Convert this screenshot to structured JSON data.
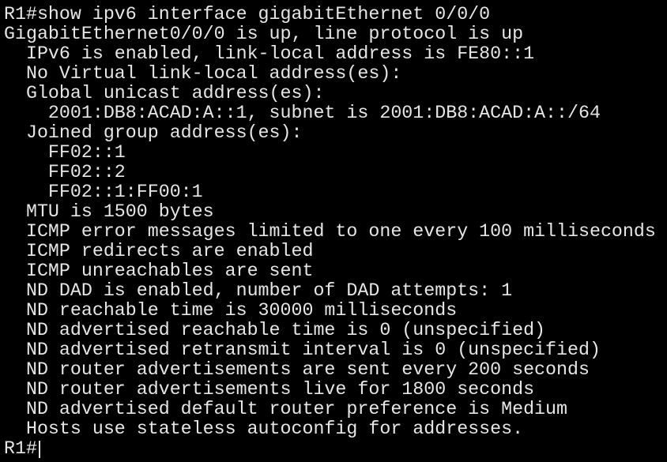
{
  "terminal": {
    "colors": {
      "background": "#000000",
      "text": "#e6e6e6"
    },
    "lines": [
      "R1#show ipv6 interface gigabitEthernet 0/0/0",
      "GigabitEthernet0/0/0 is up, line protocol is up",
      "  IPv6 is enabled, link-local address is FE80::1",
      "  No Virtual link-local address(es):",
      "  Global unicast address(es):",
      "    2001:DB8:ACAD:A::1, subnet is 2001:DB8:ACAD:A::/64",
      "  Joined group address(es):",
      "    FF02::1",
      "    FF02::2",
      "    FF02::1:FF00:1",
      "  MTU is 1500 bytes",
      "  ICMP error messages limited to one every 100 milliseconds",
      "  ICMP redirects are enabled",
      "  ICMP unreachables are sent",
      "  ND DAD is enabled, number of DAD attempts: 1",
      "  ND reachable time is 30000 milliseconds",
      "  ND advertised reachable time is 0 (unspecified)",
      "  ND advertised retransmit interval is 0 (unspecified)",
      "  ND router advertisements are sent every 200 seconds",
      "  ND router advertisements live for 1800 seconds",
      "  ND advertised default router preference is Medium",
      "  Hosts use stateless autoconfig for addresses."
    ],
    "prompt": "R1#"
  }
}
